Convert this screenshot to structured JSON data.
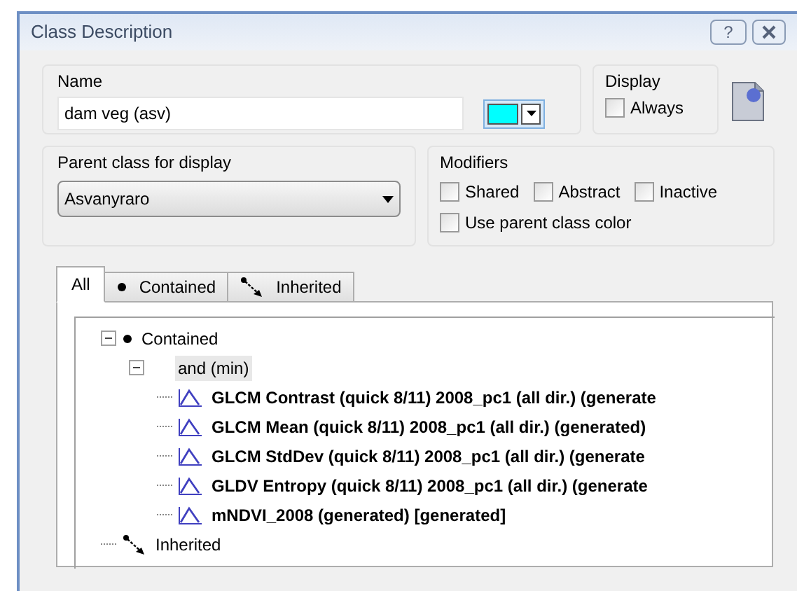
{
  "window": {
    "title": "Class Description",
    "help_button": "?"
  },
  "name": {
    "label": "Name",
    "value": "dam veg (asv)",
    "color": "#00ffff"
  },
  "display": {
    "label": "Display",
    "always": {
      "label": "Always",
      "checked": false
    }
  },
  "parent_class": {
    "label": "Parent class for display",
    "value": "Asvanyraro"
  },
  "modifiers": {
    "label": "Modifiers",
    "options": [
      {
        "label": "Shared",
        "checked": false
      },
      {
        "label": "Abstract",
        "checked": false
      },
      {
        "label": "Inactive",
        "checked": false
      },
      {
        "label": "Use parent class color",
        "checked": false
      }
    ]
  },
  "tabs": [
    {
      "label": "All",
      "kind": "all",
      "selected": true
    },
    {
      "label": "Contained",
      "kind": "contained",
      "selected": false
    },
    {
      "label": "Inherited",
      "kind": "inherited",
      "selected": false
    }
  ],
  "tree": [
    {
      "label": "Contained",
      "kind": "contained",
      "selected": false,
      "expanded": true,
      "children": [
        {
          "label": "and (min)",
          "kind": "operator",
          "selected": true,
          "expanded": true,
          "children": [
            {
              "label": "GLCM Contrast (quick 8/11) 2008_pc1 (all dir.) (generate",
              "kind": "feature",
              "selected": false
            },
            {
              "label": "GLCM Mean (quick 8/11) 2008_pc1 (all dir.) (generated)",
              "kind": "feature",
              "selected": false
            },
            {
              "label": "GLCM StdDev (quick 8/11) 2008_pc1 (all dir.) (generate",
              "kind": "feature",
              "selected": false
            },
            {
              "label": "GLDV Entropy (quick 8/11) 2008_pc1 (all dir.) (generate",
              "kind": "feature",
              "selected": false
            },
            {
              "label": "mNDVI_2008 (generated) [generated]",
              "kind": "feature",
              "selected": false
            }
          ]
        }
      ]
    },
    {
      "label": "Inherited",
      "kind": "inherited",
      "selected": false
    }
  ]
}
